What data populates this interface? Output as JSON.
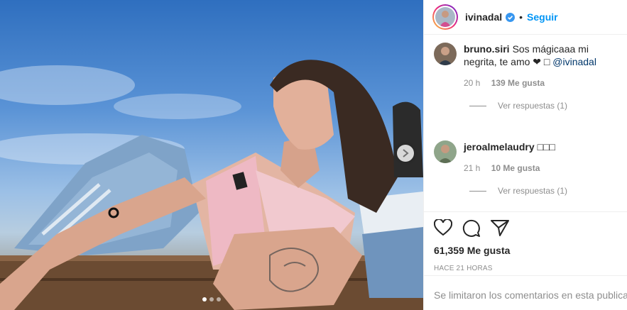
{
  "post": {
    "photo_label": "photo",
    "carousel": {
      "total": 3,
      "active": 1
    }
  },
  "header": {
    "username": "ivinadal",
    "bullet": "•",
    "follow_label": "Seguir"
  },
  "comments": [
    {
      "user": "bruno.siri",
      "text": "Sos mágicaaa mi negrita, te amo ❤ ",
      "emoji": "□",
      "mention": "@ivinadal",
      "age": "20 h",
      "likes": "139 Me gusta",
      "replies": "Ver respuestas (1)"
    },
    {
      "user": "jeroalmelaudry",
      "text": "□□□",
      "age": "21 h",
      "likes": "10 Me gusta",
      "replies": "Ver respuestas (1)"
    }
  ],
  "actions": {
    "icons": [
      "heart-icon",
      "comment-icon",
      "share-icon"
    ],
    "likes_count": "61,359 Me gusta",
    "timestamp": "HACE 21 HORAS"
  },
  "footer": {
    "limited_text": "Se limitaron los comentarios en esta publica"
  },
  "colors": {
    "accent": "#0095f6",
    "text": "#262626",
    "muted": "#8e8e8e",
    "border": "#efefef"
  }
}
